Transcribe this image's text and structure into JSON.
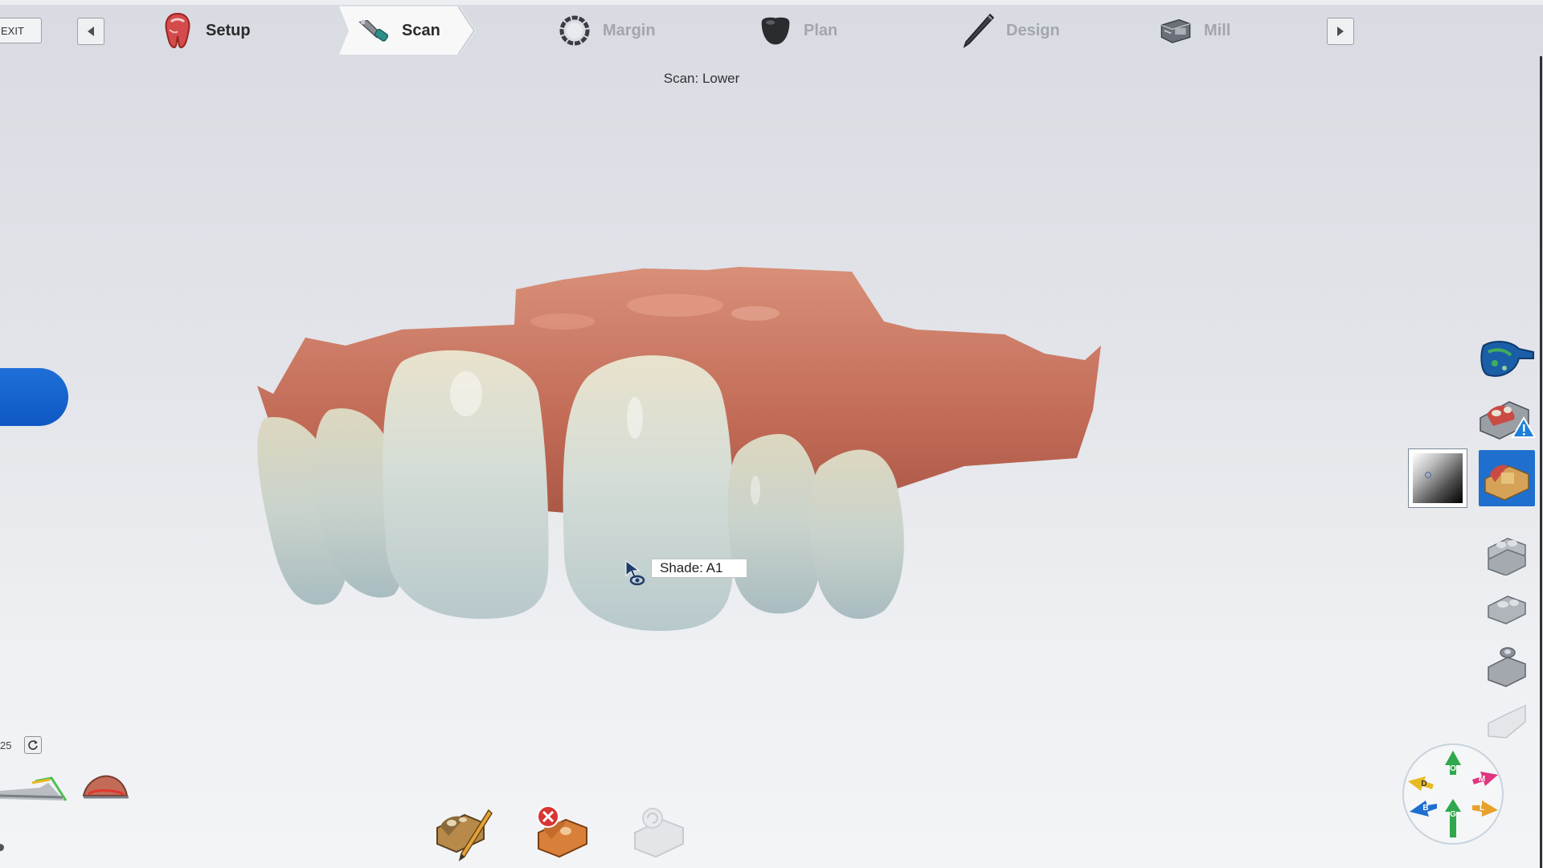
{
  "app": {
    "exit_label": "EXIT",
    "steps": [
      {
        "label": "Setup"
      },
      {
        "label": "Scan"
      },
      {
        "label": "Margin"
      },
      {
        "label": "Plan"
      },
      {
        "label": "Design"
      },
      {
        "label": "Mill"
      }
    ],
    "active_step": "Scan"
  },
  "viewport": {
    "scan_title": "Scan: Lower",
    "shade_label": "Shade:  A1"
  },
  "left_panel": {
    "counter": "25"
  },
  "colors": {
    "accent_blue": "#1f6fcf",
    "gum": "#c7735c",
    "tooth": "#cfdcd8"
  },
  "icons": {
    "prev": "chevron-left-icon",
    "next": "chevron-right-icon",
    "refresh": "refresh-icon",
    "compass_labels": [
      "O",
      "D",
      "M",
      "B",
      "L",
      "G"
    ]
  }
}
